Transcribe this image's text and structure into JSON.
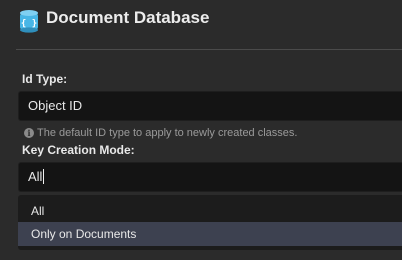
{
  "header": {
    "title": "Document Database",
    "icon": "document-database-icon"
  },
  "id_type": {
    "label": "Id Type:",
    "value": "Object ID",
    "hint": "The default ID type to apply to newly created classes.",
    "hint_icon": "info-icon"
  },
  "key_creation": {
    "label": "Key Creation Mode:",
    "value": "All",
    "options": [
      {
        "label": "All",
        "highlighted": false
      },
      {
        "label": "Only on Documents",
        "highlighted": true
      }
    ]
  },
  "colors": {
    "background": "#2b2b2b",
    "input": "#141414",
    "dropdown": "#1c1c1c",
    "highlight": "#3d4150",
    "icon_accent": "#48b6e6"
  }
}
